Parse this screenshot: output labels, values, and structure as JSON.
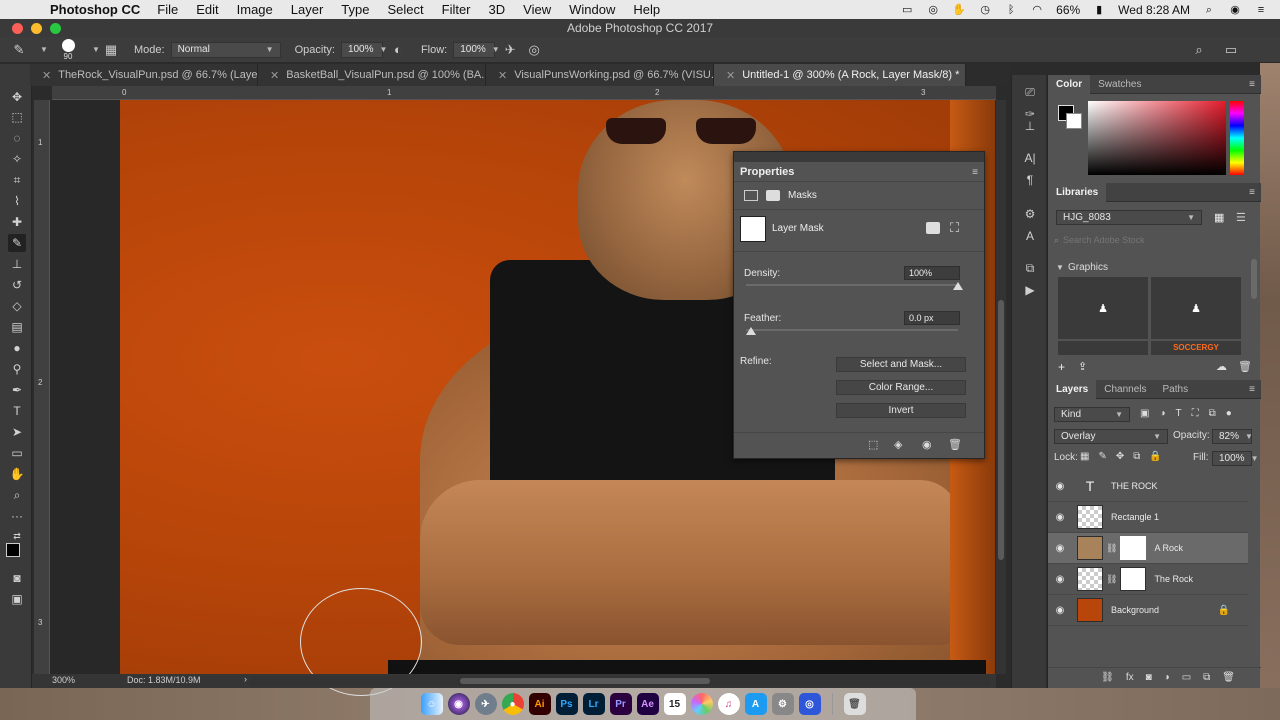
{
  "menubar": {
    "app_name": "Photoshop CC",
    "items": [
      "File",
      "Edit",
      "Image",
      "Layer",
      "Type",
      "Select",
      "Filter",
      "3D",
      "View",
      "Window",
      "Help"
    ],
    "battery": "66%",
    "clock": "Wed 8:28 AM"
  },
  "window": {
    "title": "Adobe Photoshop CC 2017"
  },
  "options": {
    "brush_size": "90",
    "mode_label": "Mode:",
    "mode_value": "Normal",
    "opacity_label": "Opacity:",
    "opacity_value": "100%",
    "flow_label": "Flow:",
    "flow_value": "100%"
  },
  "tabs": [
    {
      "label": "TheRock_VisualPun.psd @ 66.7% (Laye..."
    },
    {
      "label": "BasketBall_VisualPun.psd @ 100% (BA..."
    },
    {
      "label": "VisualPunsWorking.psd @ 66.7% (VISU..."
    },
    {
      "label": "Untitled-1 @ 300% (A Rock, Layer Mask/8) *"
    }
  ],
  "rulers": {
    "top": [
      "0",
      "1",
      "2",
      "3"
    ],
    "left": [
      "1",
      "2",
      "3"
    ]
  },
  "status": {
    "zoom": "300%",
    "doc": "Doc: 1.83M/10.9M"
  },
  "properties": {
    "title": "Properties",
    "section": "Masks",
    "mask_label": "Layer Mask",
    "density_label": "Density:",
    "density_value": "100%",
    "density": 1.0,
    "feather_label": "Feather:",
    "feather_value": "0.0 px",
    "feather": 0.0,
    "refine_label": "Refine:",
    "btn_select_mask": "Select and Mask...",
    "btn_color_range": "Color Range...",
    "btn_invert": "Invert"
  },
  "color_panel": {
    "tabs": [
      "Color",
      "Swatches"
    ]
  },
  "libraries": {
    "title": "Libraries",
    "library_name": "HJG_8083",
    "search_placeholder": "Search Adobe Stock",
    "graphics_label": "Graphics",
    "graphic_caption": "SOCCERGY"
  },
  "layers_panel": {
    "tabs": [
      "Layers",
      "Channels",
      "Paths"
    ],
    "filter": "Kind",
    "blend_mode": "Overlay",
    "opacity_label": "Opacity:",
    "opacity_value": "82%",
    "lock_label": "Lock:",
    "fill_label": "Fill:",
    "fill_value": "100%",
    "layers": [
      {
        "name": "THE ROCK"
      },
      {
        "name": "Rectangle 1"
      },
      {
        "name": "A Rock"
      },
      {
        "name": "The Rock"
      },
      {
        "name": "Background"
      }
    ]
  },
  "dock_apps": [
    "Ai",
    "Ps",
    "Lr",
    "Pr",
    "Ae",
    "15"
  ],
  "colors": {
    "accent_orange": "#b84509",
    "ps_blue": "#31a8ff",
    "ai_orange": "#ff9a00",
    "lr_blue": "#31a8ff",
    "pr_purple": "#9999ff",
    "ae_purple": "#d291ff"
  }
}
